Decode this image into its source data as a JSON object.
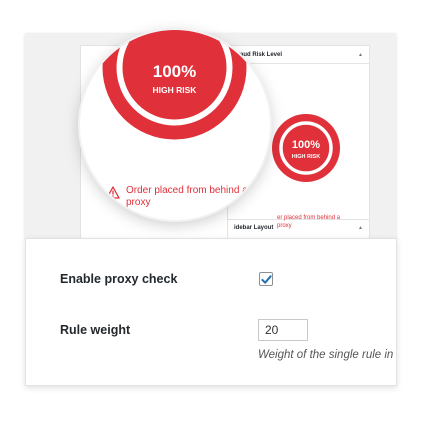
{
  "fraud_widget": {
    "title": "Fraud Risk Level",
    "percent": "100%",
    "risk_label": "HIGH RISK",
    "risk_level": 1.0,
    "warning": "Order placed from behind a proxy",
    "warning_small": "er placed from behind a\nproxy",
    "next_panel_title": "idebar Layout",
    "collapse_icon": "triangle-up-icon"
  },
  "settings": {
    "proxy_check_label": "Enable proxy check",
    "proxy_check_checked": true,
    "rule_weight_label": "Rule weight",
    "rule_weight_value": "20",
    "rule_weight_help": "Weight of the single rule in"
  },
  "colors": {
    "risk_red": "#e0303a",
    "checkbox_check": "#2271b1"
  }
}
